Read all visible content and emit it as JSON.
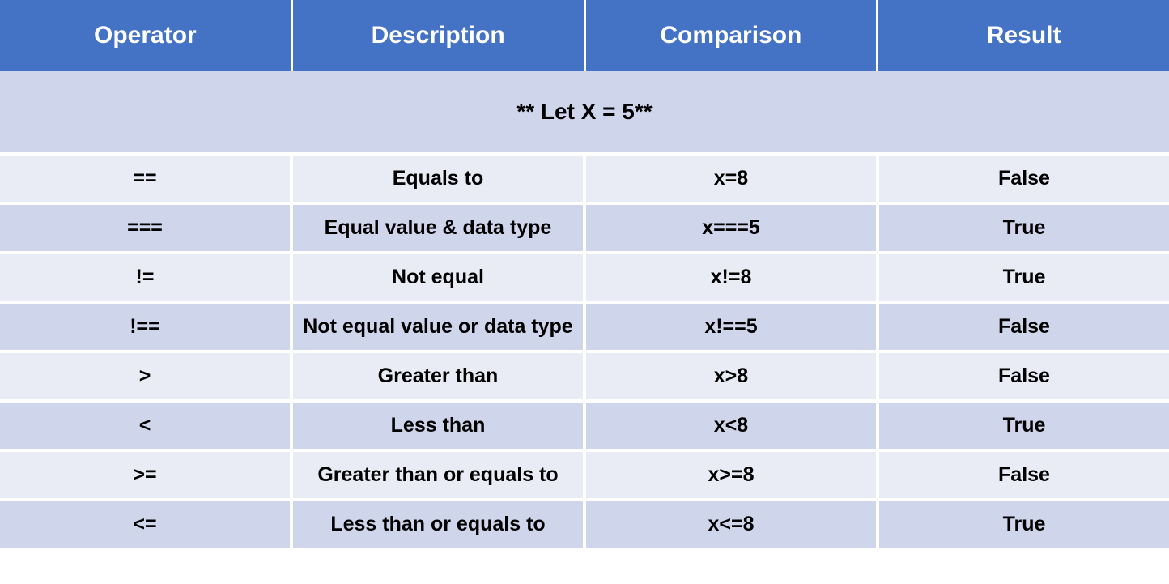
{
  "header": {
    "columns": [
      "Operator",
      "Description",
      "Comparison",
      "Result"
    ]
  },
  "subtitle": "** Let X = 5**",
  "rows": [
    {
      "operator": "==",
      "description": "Equals to",
      "comparison": "x=8",
      "result": "False"
    },
    {
      "operator": "===",
      "description": "Equal value & data type",
      "comparison": "x===5",
      "result": "True"
    },
    {
      "operator": "!=",
      "description": "Not equal",
      "comparison": "x!=8",
      "result": "True"
    },
    {
      "operator": "!==",
      "description": "Not equal value or data type",
      "comparison": "x!==5",
      "result": "False"
    },
    {
      "operator": ">",
      "description": "Greater than",
      "comparison": "x>8",
      "result": "False"
    },
    {
      "operator": "<",
      "description": "Less than",
      "comparison": "x<8",
      "result": "True"
    },
    {
      "operator": ">=",
      "description": "Greater than or equals to",
      "comparison": "x>=8",
      "result": "False"
    },
    {
      "operator": "<=",
      "description": "Less than or equals to",
      "comparison": "x<=8",
      "result": "True"
    }
  ],
  "colors": {
    "header_bg": "#4472c4",
    "stripe_a": "#e9ebf5",
    "stripe_b": "#cfd5ea"
  }
}
